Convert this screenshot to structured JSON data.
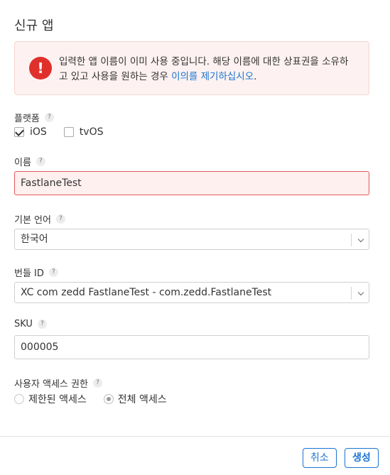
{
  "dialog": {
    "title": "신규 앱"
  },
  "alert": {
    "icon": "exclamation-icon",
    "message_line1": "입력한 앱 이름이 이미 사용 중입니다. 해당 이름에 대한 상표권을 소유하",
    "message_line2": "고 있고 사용을 원하는 경우 ",
    "link_text": "이의를 제기하십시오",
    "period": "."
  },
  "platforms": {
    "label": "플랫폼",
    "help": "?",
    "options": [
      {
        "label": "iOS",
        "checked": true
      },
      {
        "label": "tvOS",
        "checked": false
      }
    ]
  },
  "name": {
    "label": "이름",
    "help": "?",
    "value": "FastlaneTest"
  },
  "language": {
    "label": "기본 언어",
    "help": "?",
    "value": "한국어"
  },
  "bundle": {
    "label": "번들 ID",
    "help": "?",
    "value": "XC com zedd FastlaneTest - com.zedd.FastlaneTest"
  },
  "sku": {
    "label": "SKU",
    "help": "?",
    "value": "000005"
  },
  "access": {
    "label": "사용자 액세스 권한",
    "help": "?",
    "options": [
      {
        "label": "제한된 액세스",
        "checked": false
      },
      {
        "label": "전체 액세스",
        "checked": true
      }
    ]
  },
  "footer": {
    "cancel_label": "취소",
    "create_label": "생성"
  },
  "colors": {
    "accent": "#1b74d1",
    "error": "#e0302b",
    "alert_bg": "#fdf2f1"
  }
}
